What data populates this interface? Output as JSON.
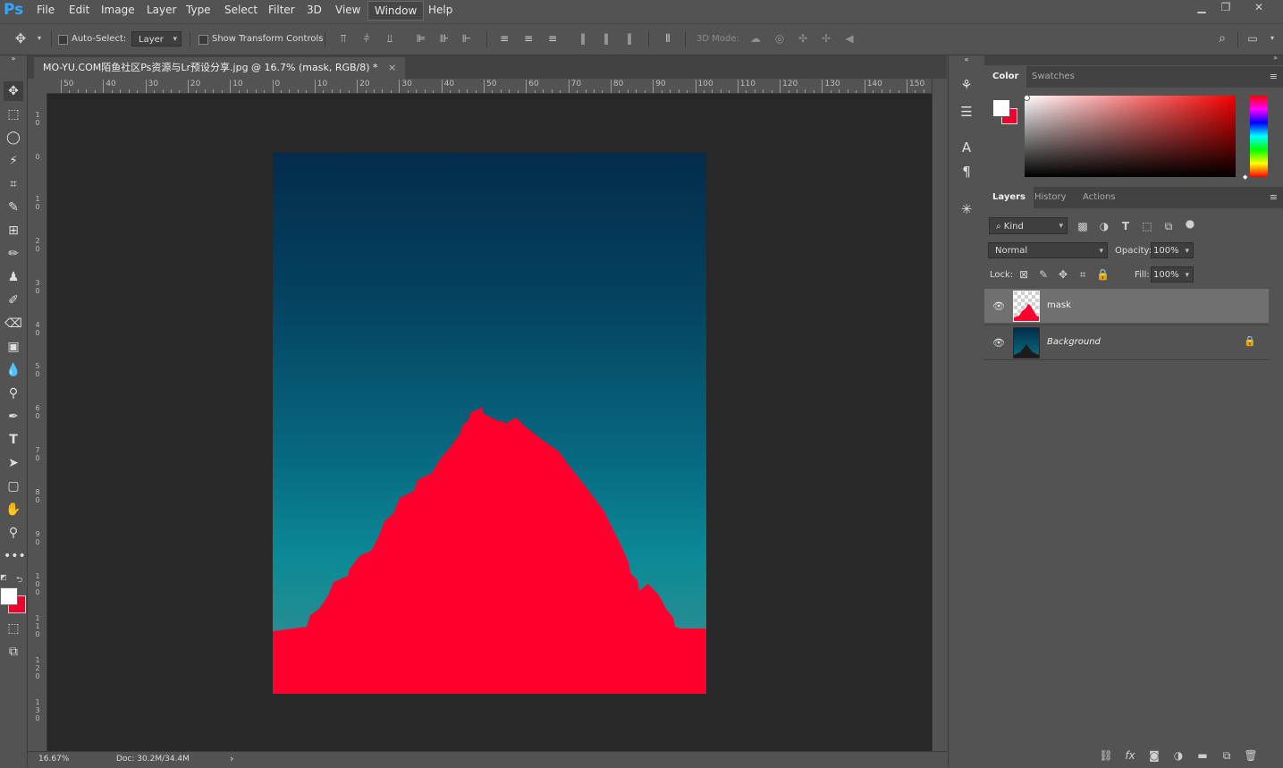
{
  "app": {
    "logo": "Ps"
  },
  "menu": [
    "File",
    "Edit",
    "Image",
    "Layer",
    "Type",
    "Select",
    "Filter",
    "3D",
    "View",
    "Window",
    "Help"
  ],
  "window_controls": {
    "minimize": "▁",
    "restore": "❐",
    "close": "✕"
  },
  "options": {
    "auto_select_label": "Auto-Select:",
    "auto_select_value": "Layer",
    "show_transform_label": "Show Transform Controls",
    "mode_3d_label": "3D Mode:"
  },
  "document": {
    "tab_title": "MO-YU.COM陌鱼社区Ps资源与Lr预设分享.jpg @ 16.7% (mask, RGB/8) *",
    "tab_close": "×"
  },
  "ruler_top_labels": [
    "50",
    "40",
    "30",
    "20",
    "10",
    "0",
    "10",
    "20",
    "30",
    "40",
    "50",
    "60",
    "70",
    "80",
    "90",
    "100",
    "110",
    "120",
    "130",
    "140",
    "150"
  ],
  "ruler_left_labels": [
    "1 0",
    "0",
    "1 0",
    "2 0",
    "3 0",
    "4 0",
    "5 0",
    "6 0",
    "7 0",
    "8 0",
    "9 0",
    "1 0 0",
    "1 1 0",
    "1 2 0",
    "1 3 0"
  ],
  "status": {
    "zoom": "16.67%",
    "doc": "Doc: 30.2M/34.4M",
    "arrow": "›"
  },
  "color_panel": {
    "tabs": [
      "Color",
      "Swatches"
    ],
    "active": "Color",
    "foreground": "#ffffff",
    "background": "#f0002e"
  },
  "layers_panel": {
    "tabs": [
      "Layers",
      "History",
      "Actions"
    ],
    "active": "Layers",
    "filter_kind": "Kind",
    "blend_mode": "Normal",
    "opacity_label": "Opacity:",
    "opacity_value": "100%",
    "lock_label": "Lock:",
    "fill_label": "Fill:",
    "fill_value": "100%",
    "layers": [
      {
        "name": "mask",
        "selected": true,
        "locked": false
      },
      {
        "name": "Background",
        "selected": false,
        "locked": true
      }
    ]
  },
  "colors": {
    "mask_red": "#ff002e",
    "accent": "#31a8ff"
  }
}
